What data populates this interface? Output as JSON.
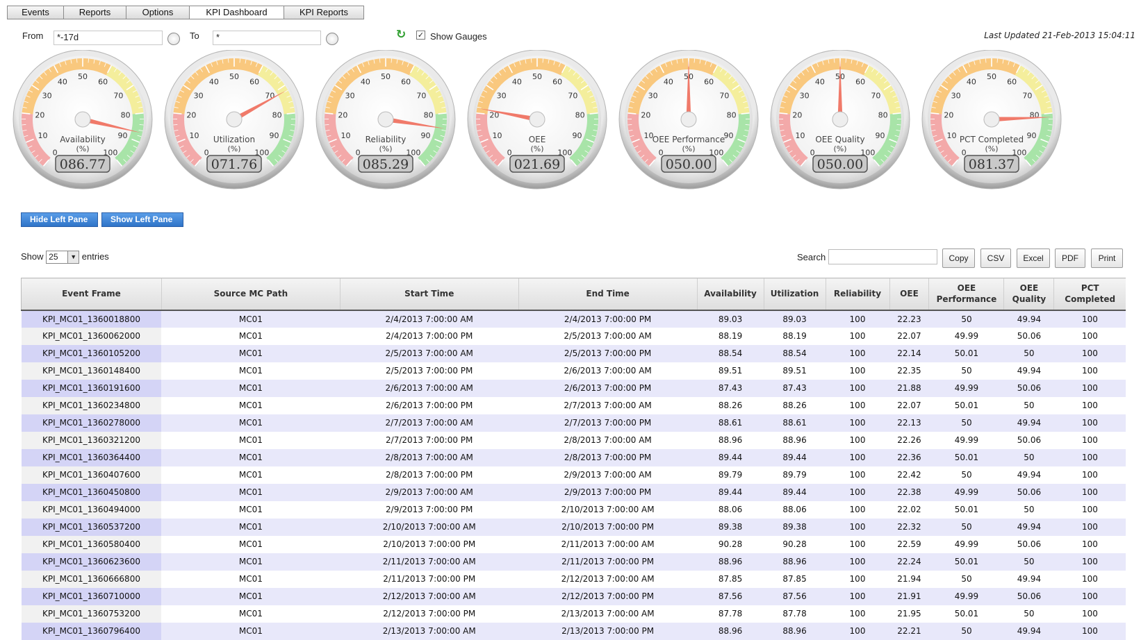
{
  "tabs": [
    "Events",
    "Reports",
    "Options",
    "KPI Dashboard",
    "KPI Reports"
  ],
  "filter": {
    "from_label": "From",
    "from_value": "*-17d",
    "to_label": "To",
    "to_value": "*",
    "show_gauges_label": "Show Gauges",
    "show_gauges_checked": true,
    "last_updated": "Last Updated 21-Feb-2013 15:04:11"
  },
  "gauges": [
    {
      "label": "Availability",
      "unit": "(%)",
      "value": 86.77,
      "display": "086.77"
    },
    {
      "label": "Utilization",
      "unit": "(%)",
      "value": 71.76,
      "display": "071.76"
    },
    {
      "label": "Reliability",
      "unit": "(%)",
      "value": 85.29,
      "display": "085.29"
    },
    {
      "label": "OEE",
      "unit": "(%)",
      "value": 21.69,
      "display": "021.69"
    },
    {
      "label": "OEE Performance",
      "unit": "(%)",
      "value": 50.0,
      "display": "050.00"
    },
    {
      "label": "OEE Quality",
      "unit": "(%)",
      "value": 50.0,
      "display": "050.00"
    },
    {
      "label": "PCT Completed",
      "unit": "(%)",
      "value": 81.37,
      "display": "081.37"
    }
  ],
  "gauge_ticks": [
    "0",
    "10",
    "20",
    "30",
    "40",
    "50",
    "60",
    "70",
    "80",
    "90",
    "100"
  ],
  "pane_buttons": {
    "hide": "Hide Left Pane",
    "show": "Show Left Pane"
  },
  "table_controls": {
    "show_label": "Show",
    "entries_value": "25",
    "entries_label": "entries",
    "search_label": "Search",
    "export_buttons": [
      "Copy",
      "CSV",
      "Excel",
      "PDF",
      "Print"
    ]
  },
  "table": {
    "columns": [
      "Event Frame",
      "Source MC Path",
      "Start Time",
      "End Time",
      "Availability",
      "Utilization",
      "Reliability",
      "OEE",
      "OEE Performance",
      "OEE Quality",
      "PCT Completed"
    ],
    "rows": [
      [
        "KPI_MC01_1360018800",
        "MC01",
        "2/4/2013 7:00:00 AM",
        "2/4/2013 7:00:00 PM",
        "89.03",
        "89.03",
        "100",
        "22.23",
        "50",
        "49.94",
        "100"
      ],
      [
        "KPI_MC01_1360062000",
        "MC01",
        "2/4/2013 7:00:00 PM",
        "2/5/2013 7:00:00 AM",
        "88.19",
        "88.19",
        "100",
        "22.07",
        "49.99",
        "50.06",
        "100"
      ],
      [
        "KPI_MC01_1360105200",
        "MC01",
        "2/5/2013 7:00:00 AM",
        "2/5/2013 7:00:00 PM",
        "88.54",
        "88.54",
        "100",
        "22.14",
        "50.01",
        "50",
        "100"
      ],
      [
        "KPI_MC01_1360148400",
        "MC01",
        "2/5/2013 7:00:00 PM",
        "2/6/2013 7:00:00 AM",
        "89.51",
        "89.51",
        "100",
        "22.35",
        "50",
        "49.94",
        "100"
      ],
      [
        "KPI_MC01_1360191600",
        "MC01",
        "2/6/2013 7:00:00 AM",
        "2/6/2013 7:00:00 PM",
        "87.43",
        "87.43",
        "100",
        "21.88",
        "49.99",
        "50.06",
        "100"
      ],
      [
        "KPI_MC01_1360234800",
        "MC01",
        "2/6/2013 7:00:00 PM",
        "2/7/2013 7:00:00 AM",
        "88.26",
        "88.26",
        "100",
        "22.07",
        "50.01",
        "50",
        "100"
      ],
      [
        "KPI_MC01_1360278000",
        "MC01",
        "2/7/2013 7:00:00 AM",
        "2/7/2013 7:00:00 PM",
        "88.61",
        "88.61",
        "100",
        "22.13",
        "50",
        "49.94",
        "100"
      ],
      [
        "KPI_MC01_1360321200",
        "MC01",
        "2/7/2013 7:00:00 PM",
        "2/8/2013 7:00:00 AM",
        "88.96",
        "88.96",
        "100",
        "22.26",
        "49.99",
        "50.06",
        "100"
      ],
      [
        "KPI_MC01_1360364400",
        "MC01",
        "2/8/2013 7:00:00 AM",
        "2/8/2013 7:00:00 PM",
        "89.44",
        "89.44",
        "100",
        "22.36",
        "50.01",
        "50",
        "100"
      ],
      [
        "KPI_MC01_1360407600",
        "MC01",
        "2/8/2013 7:00:00 PM",
        "2/9/2013 7:00:00 AM",
        "89.79",
        "89.79",
        "100",
        "22.42",
        "50",
        "49.94",
        "100"
      ],
      [
        "KPI_MC01_1360450800",
        "MC01",
        "2/9/2013 7:00:00 AM",
        "2/9/2013 7:00:00 PM",
        "89.44",
        "89.44",
        "100",
        "22.38",
        "49.99",
        "50.06",
        "100"
      ],
      [
        "KPI_MC01_1360494000",
        "MC01",
        "2/9/2013 7:00:00 PM",
        "2/10/2013 7:00:00 AM",
        "88.06",
        "88.06",
        "100",
        "22.02",
        "50.01",
        "50",
        "100"
      ],
      [
        "KPI_MC01_1360537200",
        "MC01",
        "2/10/2013 7:00:00 AM",
        "2/10/2013 7:00:00 PM",
        "89.38",
        "89.38",
        "100",
        "22.32",
        "50",
        "49.94",
        "100"
      ],
      [
        "KPI_MC01_1360580400",
        "MC01",
        "2/10/2013 7:00:00 PM",
        "2/11/2013 7:00:00 AM",
        "90.28",
        "90.28",
        "100",
        "22.59",
        "49.99",
        "50.06",
        "100"
      ],
      [
        "KPI_MC01_1360623600",
        "MC01",
        "2/11/2013 7:00:00 AM",
        "2/11/2013 7:00:00 PM",
        "88.96",
        "88.96",
        "100",
        "22.24",
        "50.01",
        "50",
        "100"
      ],
      [
        "KPI_MC01_1360666800",
        "MC01",
        "2/11/2013 7:00:00 PM",
        "2/12/2013 7:00:00 AM",
        "87.85",
        "87.85",
        "100",
        "21.94",
        "50",
        "49.94",
        "100"
      ],
      [
        "KPI_MC01_1360710000",
        "MC01",
        "2/12/2013 7:00:00 AM",
        "2/12/2013 7:00:00 PM",
        "87.56",
        "87.56",
        "100",
        "21.91",
        "49.99",
        "50.06",
        "100"
      ],
      [
        "KPI_MC01_1360753200",
        "MC01",
        "2/12/2013 7:00:00 PM",
        "2/13/2013 7:00:00 AM",
        "87.78",
        "87.78",
        "100",
        "21.95",
        "50.01",
        "50",
        "100"
      ],
      [
        "KPI_MC01_1360796400",
        "MC01",
        "2/13/2013 7:00:00 AM",
        "2/13/2013 7:00:00 PM",
        "88.96",
        "88.96",
        "100",
        "22.21",
        "50",
        "49.94",
        "100"
      ]
    ]
  },
  "colors": {
    "band_red": "#f3a9a9",
    "band_orange": "#f9c87e",
    "band_yellow": "#f4ee9c",
    "band_green": "#a8e4a8",
    "needle": "#f07a6a",
    "row_highlight": "#e8e8fa",
    "button_blue": "#2f74c8"
  }
}
